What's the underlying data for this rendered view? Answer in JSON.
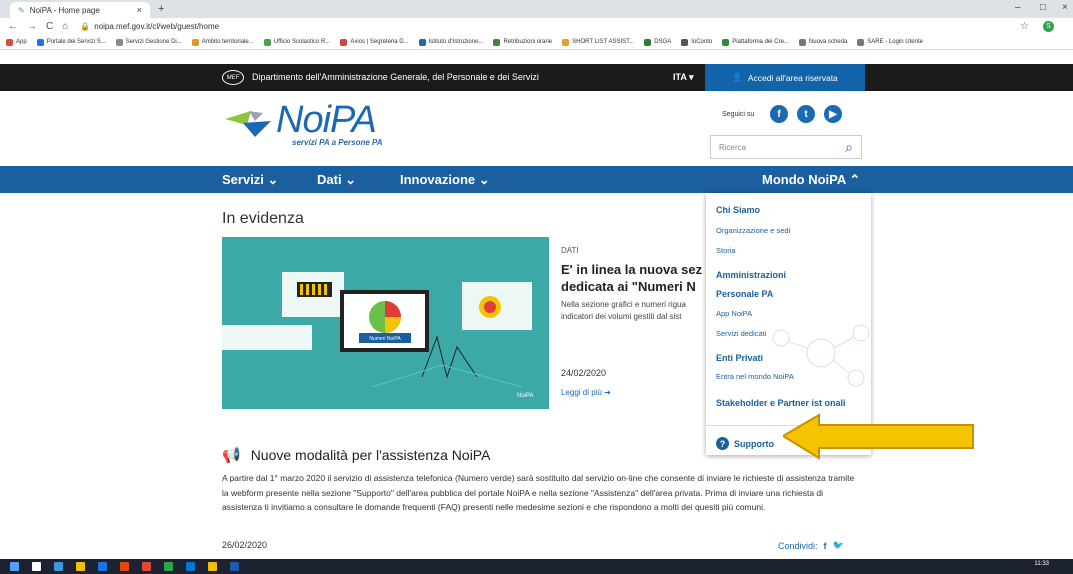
{
  "browser": {
    "tab_title": "NoiPA - Home page",
    "tab_close": "×",
    "new_tab": "+",
    "url": "noipa.mef.gov.it/cl/web/guest/home",
    "nav": [
      "←",
      "→",
      "C",
      "⌂"
    ],
    "bookmarks": [
      "App",
      "Portale dei Servizi S...",
      "Servizi Gestione Di...",
      "Ambito territoriale...",
      "Ufficio Scolastico R...",
      "Axios | Segreteria D...",
      "Istituto d'Istruzione...",
      "Retribuzioni orarie",
      "SHORT LIST ASSIST...",
      "DSGA",
      "IoConto",
      "Piattaforma dei Cre...",
      "Nuova scheda",
      "SARE - Login Utente"
    ],
    "bookmark_colors": [
      "#e0483e",
      "#1a73e8",
      "#888",
      "#d79a2b",
      "#4aa04a",
      "#c44",
      "#1b69b2",
      "#3a8a3a",
      "#e0a12c",
      "#2f7d32",
      "#555",
      "#2d8c3c",
      "#777",
      "#777"
    ]
  },
  "mef": {
    "logo": "MEF",
    "department": "Dipartimento dell'Amministrazione Generale, del Personale e dei Servizi",
    "language": "ITA",
    "login": "Accedi all'area riservata"
  },
  "header": {
    "logo_main": "NoiPA",
    "logo_sub": "servizi PA a Persone PA",
    "follow": "Seguici su",
    "search_placeholder": "Ricerca"
  },
  "menu": [
    "Servizi",
    "Dati",
    "Innovazione",
    "Mondo NoiPA"
  ],
  "main": {
    "title": "In evidenza",
    "hero_label": "Numeri NoiPA",
    "news_category": "DATI",
    "news_title_1": "E' in linea la nuova sez",
    "news_title_2": "dedicata ai \"Numeri N",
    "news_text_1": "Nella sezione grafici e numeri rigua",
    "news_text_2": "indicatori dei volumi gestiti dal sist",
    "news_date": "24/02/2020",
    "read_more": "Leggi di più",
    "hero_logo": "NoiPA"
  },
  "dropdown": {
    "items": [
      {
        "label": "Chi Siamo",
        "bold": true
      },
      {
        "label": "Organizzazione e sedi",
        "bold": false
      },
      {
        "label": "Storia",
        "bold": false
      },
      {
        "label": "Amministrazioni",
        "bold": true
      },
      {
        "label": "Personale PA",
        "bold": true
      },
      {
        "label": "App NoiPA",
        "bold": false
      },
      {
        "label": "Servizi dedicati",
        "bold": false
      },
      {
        "label": "Enti Privati",
        "bold": true
      },
      {
        "label": "Entra nel mondo NoiPA",
        "bold": false
      },
      {
        "label": "Stakeholder e Partner ist     onali",
        "bold": true
      }
    ],
    "support": "Supporto"
  },
  "section": {
    "title": "Nuove modalità per l'assistenza NoiPA",
    "body": "A partire dal 1° marzo 2020 il servizio di assistenza telefonica (Numero verde) sarà sostituito dal servizio on-line che consente di inviare le richieste di assistenza tramite la webform presente nella sezione \"Supporto\" dell'area pubblica del portale NoiPA e nella sezione \"Assistenza\" dell'area privata. Prima di inviare una richiesta di assistenza ti invitiamo a consultare le domande frequenti (FAQ) presenti nelle medesime sezioni e che rispondono a molti dei quesiti più comuni.",
    "date": "26/02/2020",
    "share": "Condividi:"
  },
  "taskbar": {
    "time": "11:33",
    "icon_colors": [
      "#4fa3ff",
      "#fff",
      "#3a96dd",
      "#f3c000",
      "#1a73e8",
      "#e8470c",
      "#e04a35",
      "#2da34a",
      "#0078d7",
      "#f3c000",
      "#1e5bb5"
    ]
  },
  "colors": {
    "brand": "#1b5f9f",
    "accent": "#1b69b2",
    "mef_bar": "#1b1b1b",
    "arrow": "#f5c400"
  }
}
